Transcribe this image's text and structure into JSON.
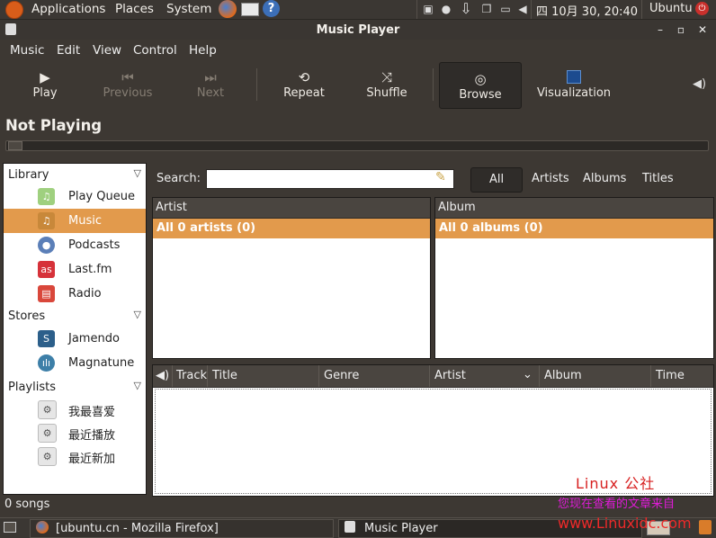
{
  "top_panel": {
    "menus": [
      "Applications",
      "Places",
      "System"
    ],
    "clock": "四 10月 30, 20:40",
    "user": "Ubuntu"
  },
  "window": {
    "title": "Music Player"
  },
  "menubar": [
    "Music",
    "Edit",
    "View",
    "Control",
    "Help"
  ],
  "toolbar": {
    "play": "Play",
    "previous": "Previous",
    "next": "Next",
    "repeat": "Repeat",
    "shuffle": "Shuffle",
    "browse": "Browse",
    "visualization": "Visualization"
  },
  "now_playing": "Not Playing",
  "sidebar": {
    "library_header": "Library",
    "library_items": [
      "Play Queue",
      "Music",
      "Podcasts",
      "Last.fm",
      "Radio"
    ],
    "stores_header": "Stores",
    "stores_items": [
      "Jamendo",
      "Magnatune"
    ],
    "playlists_header": "Playlists",
    "playlists_items": [
      "我最喜爱",
      "最近播放",
      "最近新加"
    ]
  },
  "search": {
    "label": "Search:",
    "value": "",
    "filters": [
      "All",
      "Artists",
      "Albums",
      "Titles"
    ]
  },
  "artist_pane": {
    "header": "Artist",
    "all_row": "All 0 artists (0)"
  },
  "album_pane": {
    "header": "Album",
    "all_row": "All 0 albums (0)"
  },
  "track_columns": [
    "Track",
    "Title",
    "Genre",
    "Artist",
    "Album",
    "Time"
  ],
  "status": "0 songs",
  "taskbar": {
    "firefox": "[ubuntu.cn - Mozilla Firefox]",
    "music_player": "Music Player"
  },
  "watermark": {
    "line1": "Linux 公社",
    "line2": "您现在查看的文章来自",
    "line3": "www.Linuxidc.com"
  },
  "colors": {
    "selection": "#e29a4c",
    "panel": "#3b3733",
    "window_bg": "#3d3833"
  }
}
